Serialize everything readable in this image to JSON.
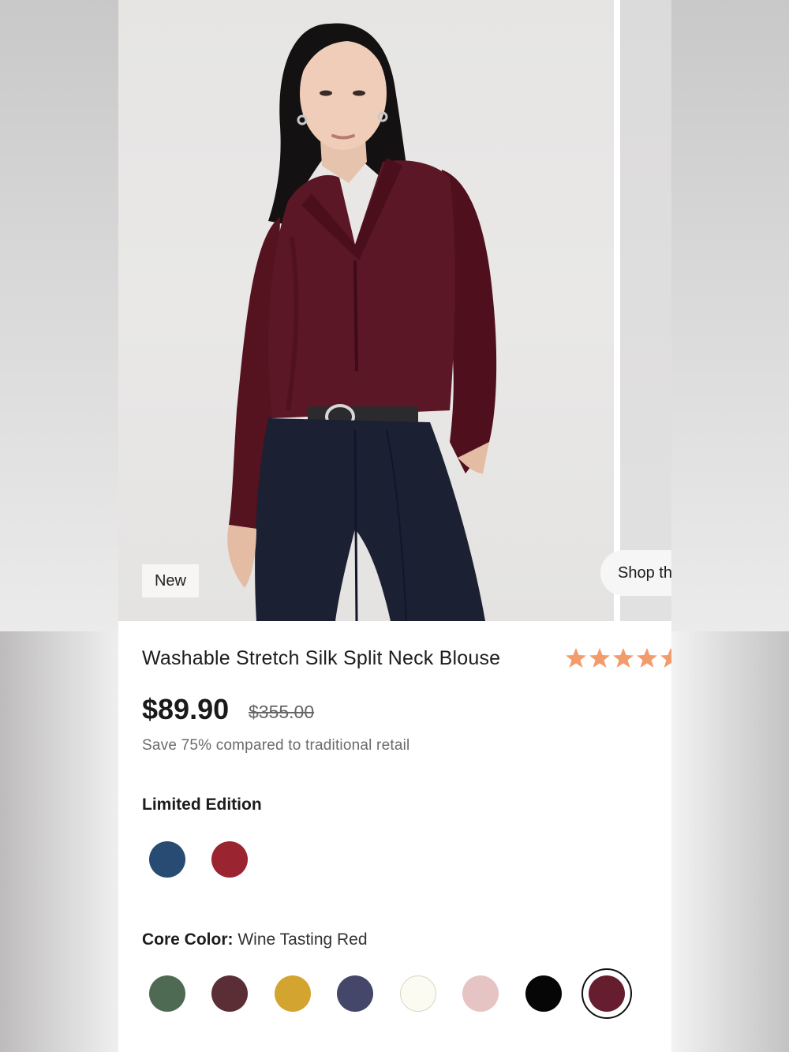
{
  "product": {
    "badge": "New",
    "shop_pill_label": "Shop th",
    "title": "Washable Stretch Silk Split Neck Blouse",
    "rating_stars": 4.5,
    "price": "$89.90",
    "original_price": "$355.00",
    "savings_text": "Save 75% compared to traditional retail"
  },
  "limited_edition": {
    "label": "Limited Edition",
    "swatches": [
      {
        "name": "navy",
        "color": "#284b74"
      },
      {
        "name": "red",
        "color": "#9a2430"
      }
    ]
  },
  "core_color": {
    "label": "Core Color:",
    "selected_name": "Wine Tasting Red",
    "swatches": [
      {
        "name": "green",
        "color": "#4f6a52"
      },
      {
        "name": "brown",
        "color": "#5a2e34"
      },
      {
        "name": "mustard",
        "color": "#d4a431"
      },
      {
        "name": "slate-blue",
        "color": "#444769"
      },
      {
        "name": "ivory",
        "color": "#fbfbf1"
      },
      {
        "name": "blush",
        "color": "#e6c4c3"
      },
      {
        "name": "black",
        "color": "#060606"
      },
      {
        "name": "wine-tasting-red",
        "color": "#661e2e",
        "selected": true
      }
    ]
  },
  "colors": {
    "star": "#f29b6b",
    "blouse": "#5c1726",
    "trousers": "#1b2033"
  }
}
